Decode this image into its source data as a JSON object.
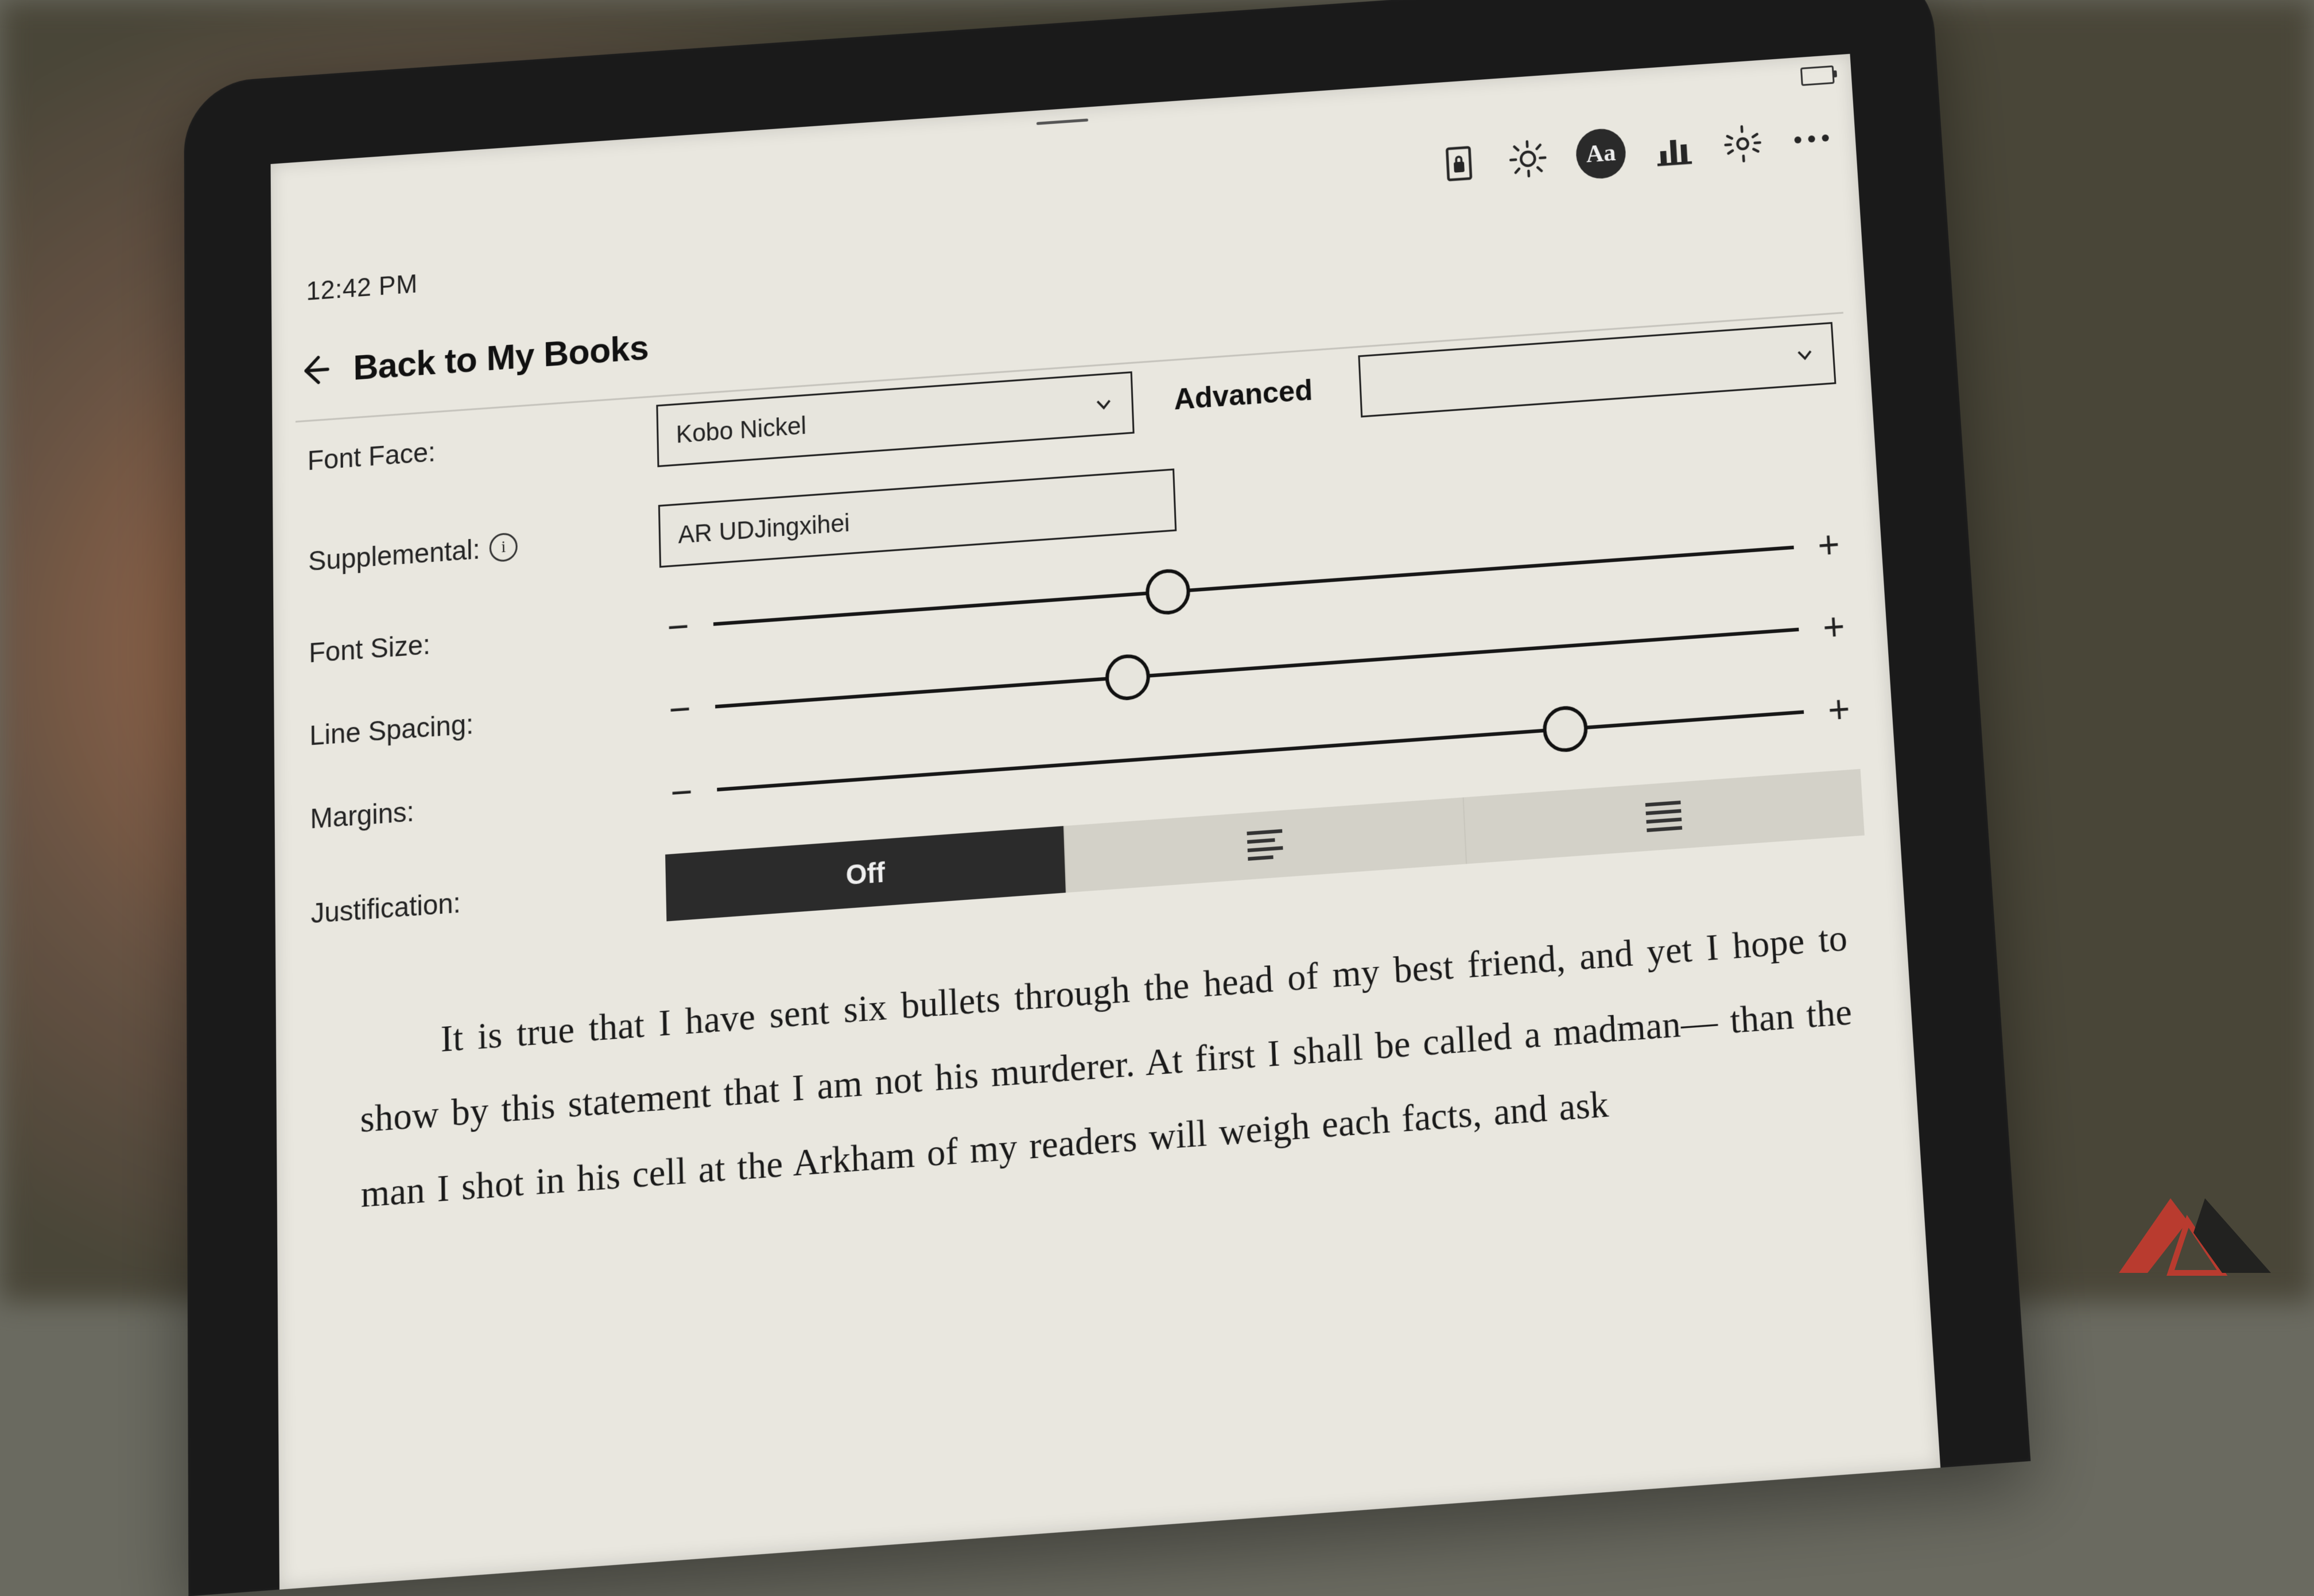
{
  "status": {
    "time": "12:42 PM"
  },
  "toolbar": {
    "icons": {
      "lock": "lock-icon",
      "brightness": "brightness-icon",
      "typography": "typography-icon",
      "stats": "reading-stats-icon",
      "settings": "gear-icon",
      "more": "more-icon"
    },
    "typography_glyph": "Aa"
  },
  "header": {
    "back_label": "Back to My Books"
  },
  "settings": {
    "font_face": {
      "label": "Font Face:",
      "value": "Kobo Nickel",
      "advanced_label": "Advanced"
    },
    "supplemental": {
      "label": "Supplemental:",
      "value": "AR UDJingxihei"
    },
    "font_size": {
      "label": "Font Size:",
      "percent": 42
    },
    "line_spacing": {
      "label": "Line Spacing:",
      "percent": 38
    },
    "margins": {
      "label": "Margins:",
      "percent": 78
    },
    "justification": {
      "label": "Justification:",
      "options": [
        "Off",
        "left",
        "full"
      ],
      "selected": "Off"
    }
  },
  "preview_text": "It is true that I have sent six bullets through the head of my best friend, and yet I hope to show by this statement that I am not his murderer. At first I shall be called a madman— than the man I shot in his cell at the Arkham of my readers will weigh each facts, and ask"
}
